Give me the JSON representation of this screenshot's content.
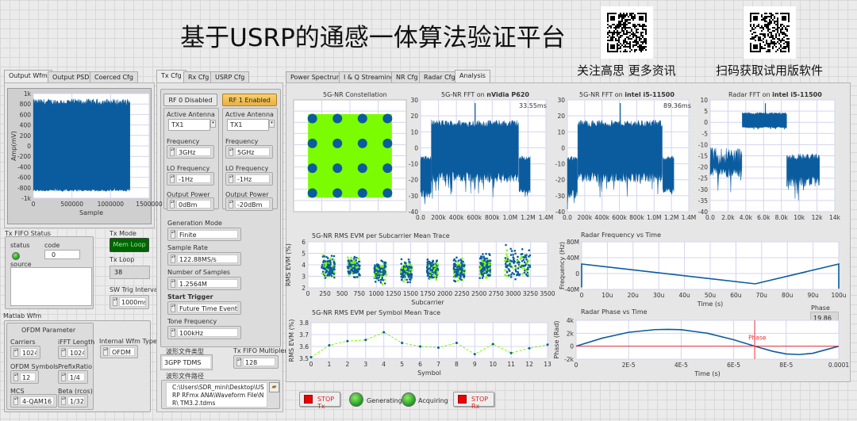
{
  "header": {
    "title": "基于USRP的通感一体算法验证平台",
    "qr_left_caption": "关注高思 更多资讯",
    "qr_right_caption": "扫码获取试用版软件"
  },
  "colors": {
    "trace": "#0b5c9e",
    "constellation_fill": "#7cfc00",
    "evm_line": "#7cfc00",
    "cursor": "#e8303a",
    "mem_loop_bg": "#006400",
    "rf1_enabled": "#f0c050"
  },
  "left_tabs": [
    {
      "label": "Output Wfm",
      "selected": true
    },
    {
      "label": "Output PSD"
    },
    {
      "label": "Coerced Cfg"
    }
  ],
  "mid_tabs": [
    {
      "label": "Tx Cfg",
      "selected": true
    },
    {
      "label": "Rx Cfg"
    },
    {
      "label": "USRP Cfg"
    }
  ],
  "right_tabs": [
    {
      "label": "Power Spectrum"
    },
    {
      "label": "I & Q Streaming"
    },
    {
      "label": "NR Cfg"
    },
    {
      "label": "Radar Cfg"
    },
    {
      "label": "Analysis",
      "selected": true
    }
  ],
  "tx_fifo": {
    "label": "Tx FIFO Status",
    "status_label": "status",
    "code_label": "code",
    "code": "0",
    "source_label": "source",
    "source": ""
  },
  "tx_mode": {
    "label": "Tx Mode",
    "value": "Mem Loop"
  },
  "tx_loop": {
    "label": "Tx Loop",
    "value": "38"
  },
  "sw_trig": {
    "label": "SW Trig Interval",
    "value": "1000ms"
  },
  "matlab": {
    "label": "Matlab Wfm",
    "ofdm_title": "OFDM Parameter",
    "carriers_label": "Carriers",
    "carriers": "1024",
    "ifft_label": "iFFT Length",
    "ifft": "1024",
    "symbols_label": "OFDM Symbols",
    "symbols": "12",
    "prefix_label": "PrefixRatio",
    "prefix": "1/4",
    "mcs_label": "MCS",
    "mcs": "4-QAM16",
    "beta_label": "Beta (rcos)",
    "beta": "1/32",
    "wfm_type_label": "Internal Wfm Type",
    "wfm_type": "OFDM"
  },
  "tx_cfg": {
    "rf0": {
      "label": "RF 0 Disabled",
      "antenna_label": "Active Antenna",
      "antenna": "TX1",
      "freq_label": "Frequency",
      "freq": "3GHz",
      "lo_label": "LO Frequency",
      "lo": "-1Hz",
      "power_label": "Output Power",
      "power": "0dBm"
    },
    "rf1": {
      "label": "RF 1 Enabled",
      "antenna_label": "Active Antenna",
      "antenna": "TX1",
      "freq_label": "Frequency",
      "freq": "5GHz",
      "lo_label": "LO Frequency",
      "lo": "-1Hz",
      "power_label": "Output Power",
      "power": "-20dBm"
    },
    "gen_mode_label": "Generation Mode",
    "gen_mode": "Finite",
    "sample_rate_label": "Sample Rate",
    "sample_rate": "122.88MS/s",
    "num_samples_label": "Number of Samples",
    "num_samples": "1.2564M",
    "start_trigger_label": "Start Trigger",
    "start_trigger": "Future Time Event",
    "tone_label": "Tone Frequency",
    "tone": "100kHz",
    "file_type_label": "波形文件类型",
    "file_type": "3GPP TDMS",
    "fifo_mult_label": "Tx FIFO Multipler",
    "fifo_mult": "128",
    "file_path_label": "波形文件路径",
    "file_path": "C:\\Users\\SDR_mini\\Desktop\\USRP RFmx ANA\\Waveform File\\NR\\ TM3.2.tdms"
  },
  "phase_indicator": {
    "label": "Phase",
    "value": "19.86"
  },
  "bottom": {
    "stop_tx": "STOP Tx",
    "generating": "Generating",
    "acquiring": "Acquiring",
    "stop_rx": "STOP Rx"
  },
  "chart_data": [
    {
      "id": "wfm",
      "type": "area",
      "title": "",
      "xlabel": "Sample",
      "ylabel": "Amp(mV)",
      "xlim": [
        0,
        1500000
      ],
      "ylim": [
        -1000,
        1000
      ],
      "xticks": [
        0,
        500000,
        1000000,
        1500000
      ],
      "xtick_labels": [
        "0",
        "500000",
        "1000000",
        "1500000"
      ],
      "yticks": [
        1000,
        800,
        600,
        400,
        200,
        0,
        -200,
        -400,
        -600,
        -800,
        -1000
      ],
      "ytick_labels": [
        "1k",
        "800",
        "600",
        "400",
        "200",
        "0",
        "-200",
        "-400",
        "-600",
        "-800",
        "-1k"
      ],
      "segments": [
        {
          "x": [
            0,
            1256400
          ],
          "upper": [
            780,
            900
          ],
          "lower": [
            -780,
            -870
          ]
        }
      ]
    },
    {
      "id": "const",
      "type": "scatter",
      "title": "5G-NR Constellation",
      "xlim": [
        -4.5,
        4.5
      ],
      "ylim": [
        -4.5,
        4.5
      ],
      "xticks": [
        -2.25,
        0,
        2.25
      ],
      "yticks": [
        -3.6,
        -2.7,
        -1.8,
        -0.9,
        0,
        0.9,
        1.8,
        2.7,
        3.6
      ],
      "fill_region": [
        -3.35,
        3.35
      ],
      "points": [
        [
          -3,
          3
        ],
        [
          -1,
          3
        ],
        [
          1,
          3
        ],
        [
          3,
          3
        ],
        [
          -3,
          1
        ],
        [
          -1,
          1
        ],
        [
          1,
          1
        ],
        [
          3,
          1
        ],
        [
          -3,
          -1
        ],
        [
          -1,
          -1
        ],
        [
          1,
          -1
        ],
        [
          3,
          -1
        ],
        [
          -3,
          -3
        ],
        [
          -1,
          -3
        ],
        [
          1,
          -3
        ],
        [
          3,
          -3
        ]
      ]
    },
    {
      "id": "fft1",
      "type": "area",
      "title": "5G-NR FFT on ",
      "title_bold": "nVidia P620",
      "annotation": "33.55ms",
      "xlim": [
        0,
        1400000
      ],
      "ylim": [
        -40,
        30
      ],
      "xticks": [
        0,
        200000,
        400000,
        600000,
        800000,
        1000000,
        1200000,
        1400000
      ],
      "xtick_labels": [
        "0.0",
        "200k",
        "400k",
        "600k",
        "800k",
        "1.0M",
        "1.2M",
        "1.4M"
      ],
      "yticks": [
        30,
        20,
        10,
        0,
        -10,
        -20,
        -30,
        -40
      ],
      "ytick_labels": [
        "30",
        "20",
        "10",
        "0",
        "-10",
        "-20",
        "-30",
        "-40"
      ],
      "segments": [
        {
          "x": [
            0,
            120000
          ],
          "upper": [
            -8,
            -5
          ],
          "lower": [
            -40,
            -26
          ]
        },
        {
          "x": [
            120000,
            1100000
          ],
          "upper": [
            13,
            17.5
          ],
          "lower": [
            -32,
            -15
          ]
        },
        {
          "x": [
            1100000,
            1230000
          ],
          "upper": [
            -8,
            -5
          ],
          "lower": [
            -33,
            -25
          ]
        }
      ],
      "spike": [
        610000,
        28
      ]
    },
    {
      "id": "fft2",
      "type": "area",
      "title": "5G-NR FFT on ",
      "title_bold": "intel i5-11500",
      "annotation": "89.36ms",
      "xlim": [
        0,
        1400000
      ],
      "ylim": [
        -40,
        30
      ],
      "xticks": [
        0,
        200000,
        400000,
        600000,
        800000,
        1000000,
        1200000,
        1400000
      ],
      "xtick_labels": [
        "0.0",
        "200k",
        "400k",
        "600k",
        "800k",
        "1.0M",
        "1.2M",
        "1.4M"
      ],
      "yticks": [
        30,
        20,
        10,
        0,
        -10,
        -20,
        -30,
        -40
      ],
      "ytick_labels": [
        "30",
        "20",
        "10",
        "0",
        "-10",
        "-20",
        "-30",
        "-40"
      ],
      "segments": [
        {
          "x": [
            0,
            120000
          ],
          "upper": [
            -8,
            -5
          ],
          "lower": [
            -40,
            -26
          ]
        },
        {
          "x": [
            120000,
            1100000
          ],
          "upper": [
            13,
            17.5
          ],
          "lower": [
            -32,
            -15
          ]
        },
        {
          "x": [
            1100000,
            1230000
          ],
          "upper": [
            -8,
            -5
          ],
          "lower": [
            -33,
            -25
          ]
        }
      ],
      "spike": [
        610000,
        28
      ]
    },
    {
      "id": "rfft",
      "type": "area",
      "title": "Radar FFT on ",
      "title_bold": "intel i5-11500",
      "xlim": [
        0,
        14000
      ],
      "ylim": [
        -40,
        10
      ],
      "xticks": [
        0,
        2000,
        4000,
        6000,
        8000,
        10000,
        12000,
        14000
      ],
      "xtick_labels": [
        "0.0",
        "2.0k",
        "4.0k",
        "6.0k",
        "8.0k",
        "10k",
        "12k",
        "14k"
      ],
      "yticks": [
        10,
        5,
        0,
        -5,
        -10,
        -15,
        -20,
        -25,
        -30,
        -35,
        -40
      ],
      "ytick_labels": [
        "10",
        "5",
        "0",
        "-5",
        "-10",
        "-15",
        "-20",
        "-25",
        "-30",
        "-35",
        "-40"
      ],
      "segments": [
        {
          "x": [
            0,
            3600
          ],
          "upper": [
            -19,
            -11
          ],
          "lower": [
            -32,
            -20
          ]
        },
        {
          "x": [
            3600,
            8600
          ],
          "upper": [
            3.5,
            4.5
          ],
          "lower": [
            -3.5,
            -2
          ]
        },
        {
          "x": [
            8600,
            12300
          ],
          "upper": [
            -17,
            -14
          ],
          "lower": [
            -36,
            -24
          ]
        }
      ],
      "spike": [
        6200,
        8.5
      ]
    },
    {
      "id": "evmsc",
      "type": "scatter",
      "title": "5G-NR RMS EVM per Subcarrier Mean Trace",
      "xlabel": "Subcarrier",
      "ylabel": "RMS EVM (%)",
      "xlim": [
        0,
        3500
      ],
      "ylim": [
        2,
        6
      ],
      "xticks": [
        0,
        250,
        500,
        750,
        1000,
        1250,
        1500,
        1750,
        2000,
        2250,
        2500,
        2750,
        3000,
        3250,
        3500
      ],
      "xtick_labels": [
        "0",
        "250",
        "500",
        "750",
        "1000",
        "1250",
        "1500",
        "1750",
        "2000",
        "2250",
        "2500",
        "2750",
        "3000",
        "3250",
        "3500"
      ],
      "yticks": [
        6,
        5,
        4,
        3,
        2
      ],
      "ytick_labels": [
        "6",
        "5",
        "4",
        "3",
        "2"
      ],
      "clusters": [
        {
          "x": [
            200,
            390
          ],
          "y": [
            2.4,
            5.1
          ]
        },
        {
          "x": [
            580,
            760
          ],
          "y": [
            2.6,
            5.0
          ]
        },
        {
          "x": [
            970,
            1140
          ],
          "y": [
            2.2,
            4.6
          ]
        },
        {
          "x": [
            1360,
            1520
          ],
          "y": [
            2.3,
            4.6
          ]
        },
        {
          "x": [
            1740,
            1900
          ],
          "y": [
            2.3,
            4.8
          ]
        },
        {
          "x": [
            2130,
            2290
          ],
          "y": [
            2.2,
            5.0
          ]
        },
        {
          "x": [
            2510,
            2670
          ],
          "y": [
            2.5,
            5.2
          ]
        },
        {
          "x": [
            2870,
            3250
          ],
          "y": [
            2.4,
            5.9
          ]
        }
      ]
    },
    {
      "id": "evmsym",
      "type": "line",
      "title": "5G-NR RMS EVM per Symbol Mean Trace",
      "xlabel": "Symbol",
      "ylabel": "RMS EVM (%)",
      "xlim": [
        0,
        13
      ],
      "ylim": [
        3.5,
        3.8
      ],
      "xticks": [
        0,
        1,
        2,
        3,
        4,
        5,
        6,
        7,
        8,
        9,
        10,
        11,
        12,
        13
      ],
      "xtick_labels": [
        "0",
        "1",
        "2",
        "3",
        "4",
        "5",
        "6",
        "7",
        "8",
        "9",
        "10",
        "11",
        "12",
        "13"
      ],
      "yticks": [
        3.8,
        3.7,
        3.6,
        3.5
      ],
      "ytick_labels": [
        "3.8",
        "3.7",
        "3.6",
        "3.5"
      ],
      "x": [
        0,
        1,
        2,
        3,
        4,
        5,
        6,
        7,
        8,
        9,
        10,
        11,
        12,
        13
      ],
      "y": [
        3.51,
        3.61,
        3.645,
        3.655,
        3.72,
        3.63,
        3.6,
        3.59,
        3.63,
        3.535,
        3.62,
        3.545,
        3.585,
        3.615
      ]
    },
    {
      "id": "rfreq",
      "type": "line",
      "title": "Radar Frequency vs Time",
      "xlabel": "Time (s)",
      "ylabel": "Frequency (Hz)",
      "xlim": [
        0,
        0.0001
      ],
      "ylim": [
        -40000000,
        80000000
      ],
      "xticks": [
        0,
        1e-05,
        2e-05,
        3e-05,
        4e-05,
        5e-05,
        6e-05,
        7e-05,
        8e-05,
        9e-05,
        0.0001
      ],
      "xtick_labels": [
        "0",
        "10u",
        "20u",
        "30u",
        "40u",
        "50u",
        "60u",
        "70u",
        "80u",
        "90u",
        "100u"
      ],
      "yticks": [
        80000000,
        40000000,
        0,
        -40000000
      ],
      "ytick_labels": [
        "80M",
        "40M",
        "0",
        "-40M"
      ],
      "x": [
        0,
        0,
        6.75e-05,
        0.0001,
        0.0001
      ],
      "y": [
        -35000000,
        24000000,
        -26000000,
        24000000,
        -38000000
      ]
    },
    {
      "id": "rphase",
      "type": "line",
      "title": "Radar Phase vs Time",
      "xlabel": "Time (s)",
      "ylabel": "Phase (Rad)",
      "xlim": [
        0,
        0.0001
      ],
      "ylim": [
        -2000,
        4000
      ],
      "xticks": [
        0,
        2e-05,
        4e-05,
        6e-05,
        8e-05,
        0.0001
      ],
      "xtick_labels": [
        "0",
        "2E-5",
        "4E-5",
        "6E-5",
        "8E-5",
        "0.0001"
      ],
      "yticks": [
        4000,
        2000,
        0,
        -2000
      ],
      "ytick_labels": [
        "4k",
        "2k",
        "0",
        "-2k"
      ],
      "x": [
        0,
        1e-05,
        2e-05,
        3e-05,
        3.5e-05,
        4e-05,
        5e-05,
        6e-05,
        6.8e-05,
        7.5e-05,
        8e-05,
        8.5e-05,
        9e-05,
        0.0001
      ],
      "y": [
        0,
        1250,
        2150,
        2560,
        2600,
        2550,
        2000,
        1000,
        0,
        -800,
        -1200,
        -1280,
        -1100,
        0
      ],
      "cursor": {
        "label": "Phase",
        "x": 6.8e-05
      }
    }
  ]
}
